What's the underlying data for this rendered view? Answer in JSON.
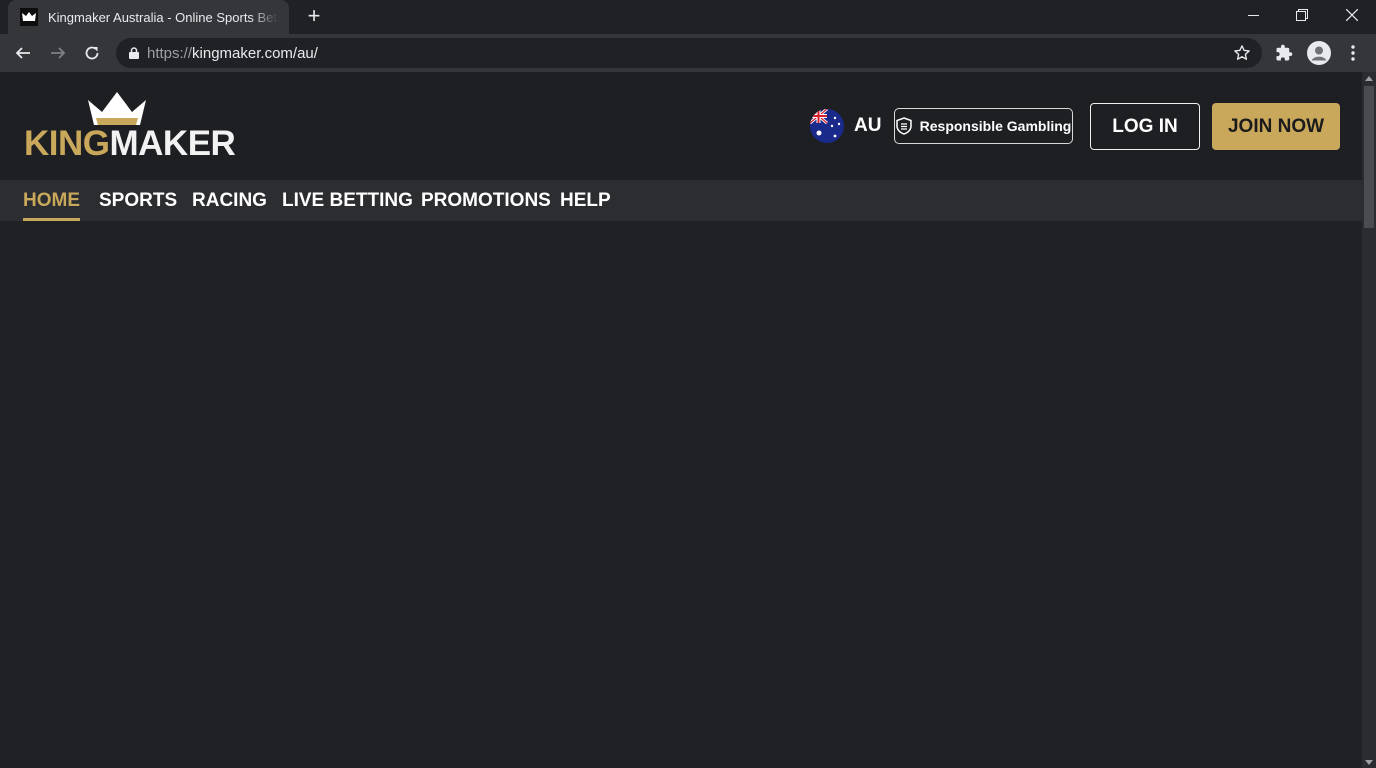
{
  "browser": {
    "tab_title": "Kingmaker Australia - Online Sports Betting",
    "url_scheme": "https://",
    "url_host": "kingmaker.com/au/"
  },
  "header": {
    "logo_part1": "KING",
    "logo_part2": "MAKER",
    "region_label": "AU",
    "responsible_gambling_label": "Responsible Gambling",
    "login_label": "LOG IN",
    "join_label": "JOIN NOW"
  },
  "nav": {
    "items": [
      {
        "label": "HOME",
        "active": true
      },
      {
        "label": "SPORTS"
      },
      {
        "label": "RACING"
      },
      {
        "label": "LIVE BETTING"
      },
      {
        "label": "PROMOTIONS"
      },
      {
        "label": "HELP"
      }
    ]
  },
  "colors": {
    "accent": "#c9a85c",
    "background": "#1f2023",
    "nav_background": "#2c2d31"
  }
}
